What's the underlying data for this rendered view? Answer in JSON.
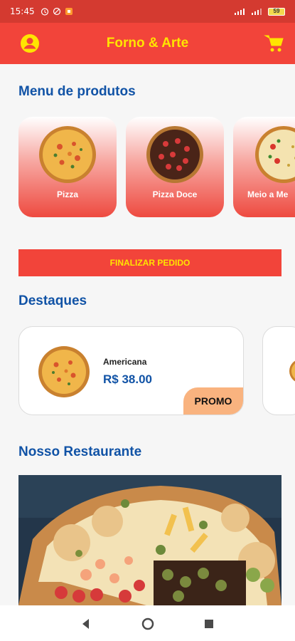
{
  "status_bar": {
    "time": "15:45",
    "battery": "59"
  },
  "app_bar": {
    "title": "Forno & Arte",
    "left_icon": "account-icon",
    "right_icon": "cart-icon"
  },
  "menu": {
    "title": "Menu de produtos",
    "categories": [
      {
        "label": "Pizza"
      },
      {
        "label": "Pizza Doce"
      },
      {
        "label": "Meio a Me"
      }
    ]
  },
  "finalizar_label": "FINALIZAR PEDIDO",
  "destaques": {
    "title": "Destaques",
    "items": [
      {
        "name": "Americana",
        "price": "R$ 38.00",
        "badge": "PROMO"
      }
    ]
  },
  "restaurante": {
    "title": "Nosso Restaurante"
  },
  "colors": {
    "primary": "#f2443a",
    "accent_text": "#ffe400",
    "heading": "#1153a6",
    "promo": "#f9b37f"
  }
}
